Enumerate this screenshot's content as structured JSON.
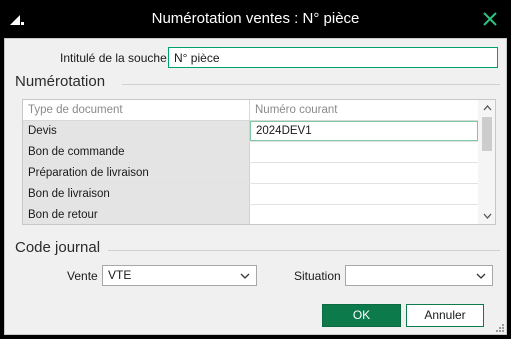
{
  "window": {
    "title": "Numérotation ventes :  N° pièce"
  },
  "souche": {
    "label": "Intitulé de la souche",
    "value": "N° pièce"
  },
  "numerotation": {
    "title": "Numérotation",
    "columns": [
      "Type de document",
      "Numéro courant"
    ],
    "rows": [
      {
        "type": "Devis",
        "numero": "2024DEV1"
      },
      {
        "type": "Bon de commande",
        "numero": ""
      },
      {
        "type": "Préparation de livraison",
        "numero": ""
      },
      {
        "type": "Bon de livraison",
        "numero": ""
      },
      {
        "type": "Bon de retour",
        "numero": ""
      }
    ]
  },
  "journal": {
    "title": "Code journal",
    "vente_label": "Vente",
    "vente_value": "VTE",
    "situation_label": "Situation",
    "situation_value": ""
  },
  "buttons": {
    "ok": "OK",
    "cancel": "Annuler"
  },
  "colors": {
    "accent": "#0d7a4c",
    "close": "#2ec27e",
    "titlebar": "#000000"
  }
}
